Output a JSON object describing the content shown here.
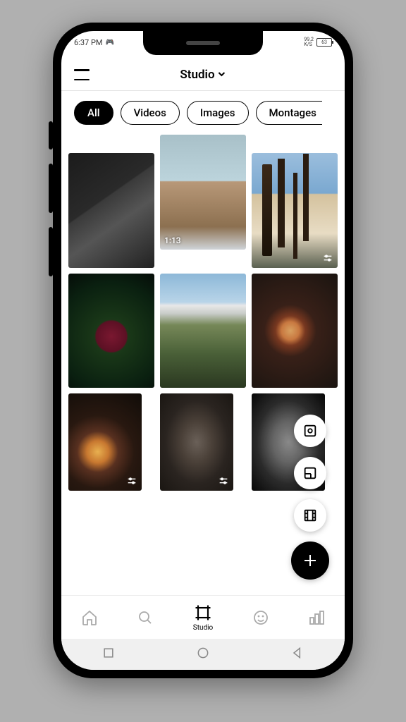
{
  "status": {
    "time": "6:37 PM",
    "net_speed": "99.2",
    "net_unit": "K/S",
    "battery": "63"
  },
  "header": {
    "title": "Studio"
  },
  "filters": {
    "all": "All",
    "videos": "Videos",
    "images": "Images",
    "montages": "Montages"
  },
  "grid": {
    "item2_duration": "1:13"
  },
  "nav": {
    "studio_label": "Studio"
  }
}
